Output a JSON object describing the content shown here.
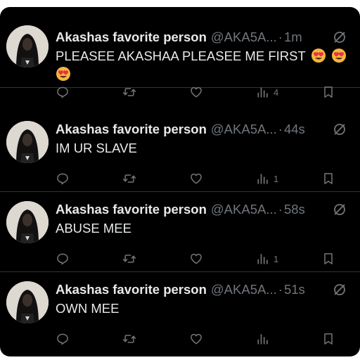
{
  "tweets": [
    {
      "author_name": "Akashas favorite person",
      "handle": "@AKA5A...",
      "separator": "·",
      "time": "1m",
      "text": "PLEASEE AKASHAA PLEASEE ME FIRST",
      "emojis": [
        "heart-eyes-emoji",
        "heart-eyes-emoji",
        "heart-eyes-emoji"
      ],
      "views": "4"
    },
    {
      "author_name": "Akashas favorite person",
      "handle": "@AKA5A...",
      "separator": "·",
      "time": "44s",
      "text": "IM UR SLAVE",
      "emojis": [],
      "views": "1"
    },
    {
      "author_name": "Akashas favorite person",
      "handle": "@AKA5A...",
      "separator": "·",
      "time": "58s",
      "text": "ABUSE MEE",
      "emojis": [],
      "views": "1"
    },
    {
      "author_name": "Akashas favorite person",
      "handle": "@AKA5A...",
      "separator": "·",
      "time": "51s",
      "text": "OWN MEE",
      "emojis": [],
      "views": ""
    }
  ],
  "icons": {
    "reply": "reply-icon",
    "retweet": "retweet-icon",
    "like": "like-icon",
    "views": "views-icon",
    "bookmark": "bookmark-icon",
    "more": "grok-icon"
  },
  "colors": {
    "background": "#000000",
    "text": "#e7e9ea",
    "secondary": "#71767b",
    "divider": "#2f3336"
  }
}
